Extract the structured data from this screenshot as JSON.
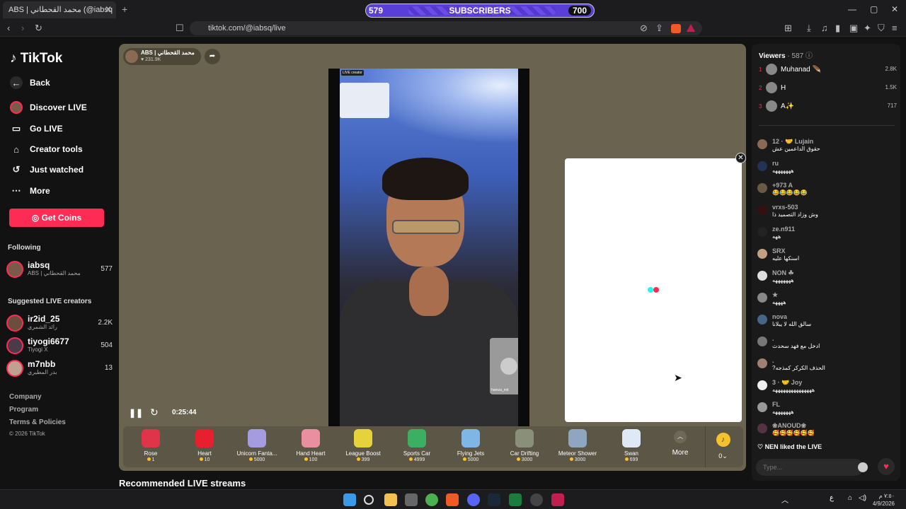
{
  "browser": {
    "tab_title": "ABS | محمد القحطاني (@iabsq",
    "tab_close": "✕",
    "new_tab": "+",
    "url": "tiktok.com/@iabsq/live",
    "subscriber_goal": {
      "current": "579",
      "label": "SUBSCRIBERS",
      "target": "700",
      "progress": 0.83
    },
    "window_controls": [
      "—",
      "▢",
      "✕"
    ]
  },
  "sidebar": {
    "logo": "TikTok",
    "nav": [
      {
        "label": "Back",
        "icon": "back-arrow-icon",
        "glyph": "←"
      },
      {
        "label": "Discover LIVE",
        "icon": "discover-avatar-icon",
        "glyph": ""
      },
      {
        "label": "Go LIVE",
        "icon": "video-camera-icon",
        "glyph": "▭"
      },
      {
        "label": "Creator tools",
        "icon": "home-icon",
        "glyph": "⌂"
      },
      {
        "label": "Just watched",
        "icon": "history-icon",
        "glyph": "↺"
      },
      {
        "label": "More",
        "icon": "more-dots-icon",
        "glyph": "⋯"
      }
    ],
    "get_coins": "Get Coins",
    "following_title": "Following",
    "following": [
      {
        "name": "iabsq",
        "sub": "ABS | محمد القحطاني",
        "count": "577"
      }
    ],
    "suggested_title": "Suggested LIVE creators",
    "suggested": [
      {
        "name": "ir2id_25",
        "sub": "رائد الشمري",
        "count": "2.2K"
      },
      {
        "name": "tiyogi6677",
        "sub": "Tiyogi X",
        "count": "504"
      },
      {
        "name": "m7nbb",
        "sub": "بدر المطيري",
        "count": "13"
      }
    ],
    "footer": [
      "Company",
      "Program",
      "Terms & Policies",
      "© 2026 TikTok"
    ]
  },
  "stream": {
    "host_name": "ABS | محمد القحطاني",
    "host_likes": "♥ 231.9K",
    "live_tag": "LIVE creator",
    "guest_name": "hamza_mit",
    "time": "0:25:44",
    "pause_glyph": "❚❚",
    "refresh_glyph": "↻",
    "close_glyph": "✕"
  },
  "gifts": [
    {
      "name": "Rose",
      "price": "1",
      "color": "#e0344a"
    },
    {
      "name": "Heart",
      "price": "10",
      "color": "#e81f2f"
    },
    {
      "name": "Unicorn Fanta...",
      "price": "5000",
      "color": "#a59be0"
    },
    {
      "name": "Hand Heart",
      "price": "100",
      "color": "#e98fa0"
    },
    {
      "name": "League Boost",
      "price": "399",
      "color": "#e6d23a"
    },
    {
      "name": "Sports Car",
      "price": "4999",
      "color": "#3bb063"
    },
    {
      "name": "Flying Jets",
      "price": "5000",
      "color": "#7fb6e6"
    },
    {
      "name": "Car Drifting",
      "price": "3000",
      "color": "#8a8f7a"
    },
    {
      "name": "Meteor Shower",
      "price": "3000",
      "color": "#8fa6c0"
    },
    {
      "name": "Swan",
      "price": "699",
      "color": "#dfe9f5"
    }
  ],
  "gift_more": "More",
  "coins": {
    "balance": "0",
    "glyph": "♪"
  },
  "recommended_title": "Recommended LIVE streams",
  "chat": {
    "viewers_label": "Viewers",
    "viewers_count": "· 587",
    "top_viewers": [
      {
        "rank": "1",
        "name": "Muhanad 🪶",
        "score": "2.8K"
      },
      {
        "rank": "2",
        "name": "H",
        "score": "1.5K"
      },
      {
        "rank": "3",
        "name": "A✨",
        "score": "717"
      }
    ],
    "messages": [
      {
        "name": "12 · 🤝 Lujain",
        "text": "حقوق الداعمين عش"
      },
      {
        "name": "ru",
        "text": "هههههههه"
      },
      {
        "name": "+973 A",
        "text": "😂😂😂😂😂"
      },
      {
        "name": "vrxs-503",
        "text": "وش وزاد التصميد ذا"
      },
      {
        "name": "ze.n911",
        "text": "ههه"
      },
      {
        "name": "SRX",
        "text": "اسنكها عليه"
      },
      {
        "name": "NON ☘",
        "text": "هههههههه"
      },
      {
        "name": "★",
        "text": "ههههه"
      },
      {
        "name": "nova",
        "text": "سالق الله لا يبلانا"
      },
      {
        "name": ".",
        "text": "ادخل مع فهد سحدث"
      },
      {
        "name": ".",
        "text": "?الحذف الكركر كمذجه"
      },
      {
        "name": "3 · 🤝 Joy",
        "text": "هههههههههههههههه"
      },
      {
        "name": "FL",
        "text": "هههههههه"
      },
      {
        "name": "❀ANOUD❀",
        "text": "🥰🥰🥰🥰🥰🥰"
      }
    ],
    "liked_text": "NEN liked the LIVE",
    "input_placeholder": "Type..."
  },
  "taskbar": {
    "time": "٧:٥٠ م",
    "date": "4/9/2026",
    "lang": "ع"
  }
}
